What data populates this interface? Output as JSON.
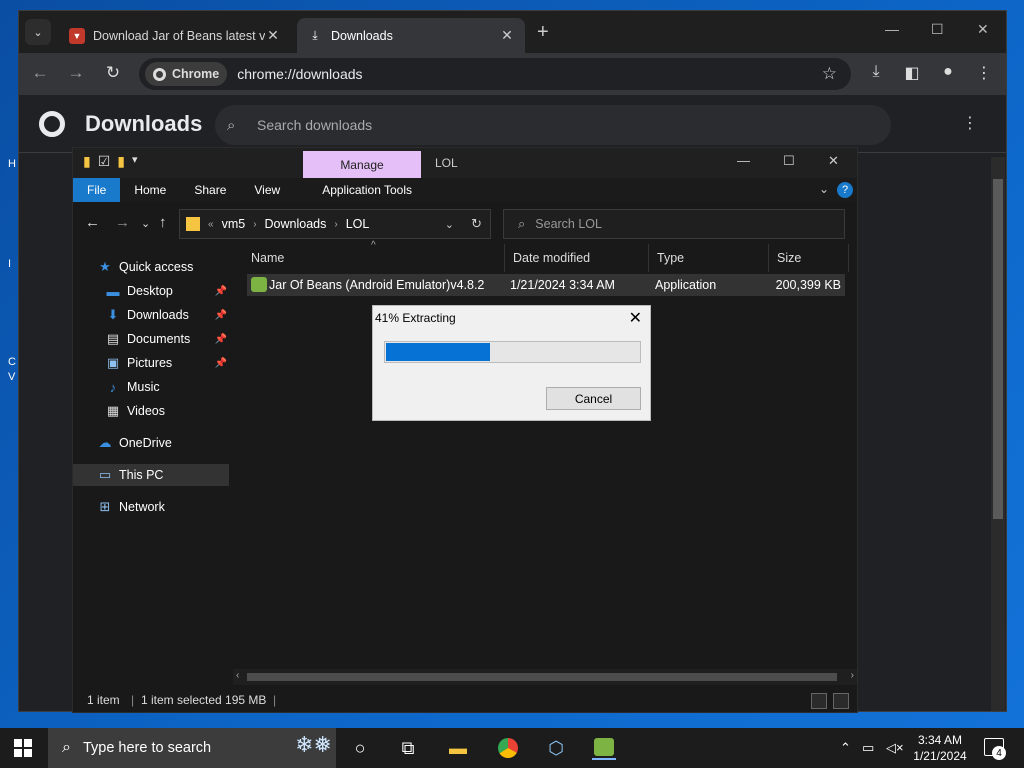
{
  "desktop": {
    "left_icon_letters": [
      "H",
      "I",
      "C",
      "V"
    ]
  },
  "chrome": {
    "tabs": [
      {
        "title": "Download Jar of Beans latest v",
        "active": false
      },
      {
        "title": "Downloads",
        "active": true
      }
    ],
    "omnibox": {
      "chip": "Chrome",
      "url": "chrome://downloads"
    },
    "downloads_page": {
      "title": "Downloads",
      "search_placeholder": "Search downloads"
    }
  },
  "explorer": {
    "title_tab": "Manage",
    "title": "LOL",
    "ribbon_tabs": [
      "File",
      "Home",
      "Share",
      "View",
      "Application Tools"
    ],
    "breadcrumb": [
      "vm5",
      "Downloads",
      "LOL"
    ],
    "search_placeholder": "Search LOL",
    "nav": [
      {
        "label": "Quick access",
        "icon": "star-icon",
        "pinned": false
      },
      {
        "label": "Desktop",
        "icon": "desktop-icon",
        "pinned": true
      },
      {
        "label": "Downloads",
        "icon": "download-icon",
        "pinned": true
      },
      {
        "label": "Documents",
        "icon": "document-icon",
        "pinned": true
      },
      {
        "label": "Pictures",
        "icon": "picture-icon",
        "pinned": true
      },
      {
        "label": "Music",
        "icon": "music-icon",
        "pinned": false
      },
      {
        "label": "Videos",
        "icon": "video-icon",
        "pinned": false
      },
      {
        "label": "OneDrive",
        "icon": "cloud-icon",
        "pinned": false
      },
      {
        "label": "This PC",
        "icon": "computer-icon",
        "pinned": false
      },
      {
        "label": "Network",
        "icon": "network-icon",
        "pinned": false
      }
    ],
    "columns": [
      "Name",
      "Date modified",
      "Type",
      "Size"
    ],
    "files": [
      {
        "name": "Jar Of Beans (Android Emulator)v4.8.2",
        "date": "1/21/2024 3:34 AM",
        "type": "Application",
        "size": "200,399 KB"
      }
    ],
    "status": {
      "count": "1 item",
      "selected": "1 item selected  195 MB"
    }
  },
  "dialog": {
    "title": "41% Extracting",
    "progress": 0.41,
    "cancel_label": "Cancel"
  },
  "taskbar": {
    "search_placeholder": "Type here to search",
    "time": "3:34 AM",
    "date": "1/21/2024",
    "notification_count": "4"
  },
  "colors": {
    "accent": "#1979ca",
    "progress_fill": "#0672d6",
    "manage_tab": "#e5bff7"
  }
}
